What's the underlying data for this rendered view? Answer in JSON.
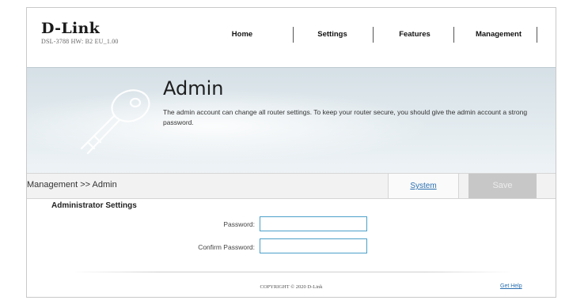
{
  "header": {
    "brand": "D-Link",
    "model_info": "DSL-3788  HW: B2  EU_1.00",
    "nav": [
      {
        "label": "Home"
      },
      {
        "label": "Settings"
      },
      {
        "label": "Features"
      },
      {
        "label": "Management"
      }
    ]
  },
  "banner": {
    "title": "Admin",
    "description": "The admin account can change all router settings. To keep your router secure, you should give the admin account a strong password.",
    "icon": "key-icon"
  },
  "action_bar": {
    "breadcrumb": "Management >> Admin",
    "system_label": "System",
    "save_label": "Save"
  },
  "form": {
    "section_title": "Administrator Settings",
    "password_label": "Password:",
    "password_value": "",
    "confirm_label": "Confirm Password:",
    "confirm_value": ""
  },
  "footer": {
    "copyright": "COPYRIGHT © 2020 D-Link",
    "help_label": "Get Help"
  },
  "colors": {
    "link": "#2a6fb0",
    "save_disabled": "#c7c7c7",
    "input_border": "#4ca0c9"
  }
}
